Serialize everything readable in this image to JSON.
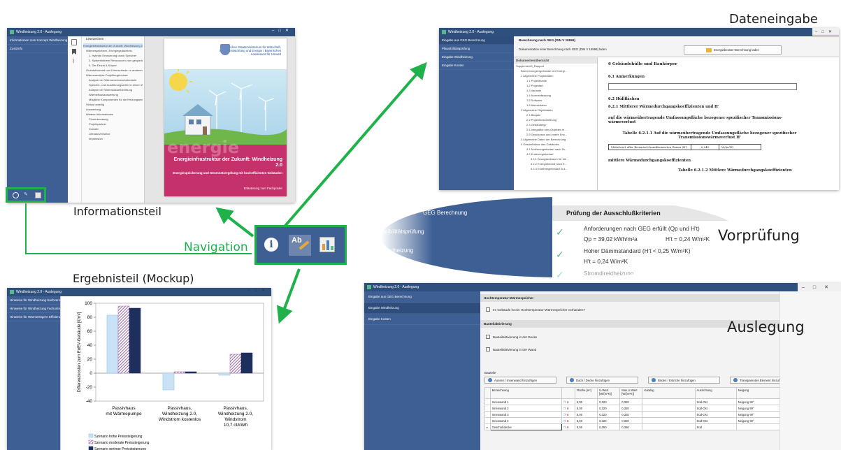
{
  "captions": {
    "dateneingabe": "Dateneingabe",
    "informationsteil": "Informationsteil",
    "navigation": "Navigation",
    "ergebnisteil": "Ergebnisteil (Mockup)",
    "vorpruefung": "Vorprüfung",
    "auslegung": "Auslegung"
  },
  "colors": {
    "accent_green": "#1fb24a",
    "sidebar_blue": "#3d5f94",
    "titlebar": "#2f4f7d",
    "check_green": "#58b88c",
    "poster_magenta": "#c5316a"
  },
  "nav_icons": [
    "info-icon",
    "spellcheck-icon",
    "chart-icon"
  ],
  "info_window": {
    "title": "Windheizung 2.0 - Auslegung",
    "sidebar": [
      "Informationen zum Konzept Windheizung",
      "Zustzinfo"
    ],
    "pane_title": "Lesezeichen",
    "tree": [
      "Energieinfrastruktur der Zukunft: Windheizung 2.0",
      "Wärmespeichern, Energiegedächtnis",
      "1. Hybride Erneuerung durch Speicher",
      "2. Systemhöhere Ressourcen zum gesparten Wärmebedarf",
      "3. Der Einzel & Körper",
      "Grundstücksart und Unterschiede zu anderen Formen der Wärmeerzeugung",
      "Wärmeanalyse Projektergebnisse",
      "Analyse der Wärmeverbrauchsbedarfe",
      "Speicher- und Ausführungsarten in einem Wohnbestand",
      "Analyse der Warmwasserbereitung",
      "Wärmeflussauswertung",
      "Mögliche Komponenten für die Heizungseinrichtung",
      "Verlust anteilig",
      "Auswertung",
      "Weitere Informationen",
      "Förderberatung",
      "Projektpartner",
      "Kontakt",
      "Literaturverweise",
      "Impressum"
    ],
    "poster": {
      "header": "Bayerisches Staatsministerium für Wirtschaft, Landesentwicklung und Energie / Bayerisches Landesamt für Umwelt",
      "watermark": "energie",
      "title": "Energieinfrastruktur der Zukunft: Windheizung 2.0",
      "subtitle": "Energiespeicherung und Stromnetzregelung mit hocheffizienten Gebäuden",
      "footer": "Erläuterung zum Fachposter"
    }
  },
  "data_window": {
    "title": "Windheizung 2.0 - Auslegung",
    "sidebar": [
      "Eingabe aus GEG Berechnung",
      "Plausibilitätsprüfung",
      "Eingabe Windheizung",
      "Eingabe Kosten"
    ],
    "header": "Berechnung nach GEG (DIN V 18599)",
    "desc": "Dokumentation einer Berechnung nach GEG (DIN V 18599) laden",
    "load_button": "Energieberater-Berechnung laden",
    "tree_header": "Dokumentenübersicht",
    "tree": [
      "Supplement3_Rapport",
      "Berechnungsergebnisse der Energi...",
      "1 Allgemeine Projektdaten",
      "1.1 Projektname",
      "1.2 Projektart",
      "1.3 Variante",
      "1.4 Normenfassung",
      "1.5 Software",
      "1.6 Adressdaten",
      "2 Allgemeine Objektdaten",
      "2.1 Baujahr",
      "2.2 Projektbeschreibung",
      "2.3 Gebäudetyp",
      "2.4 Integration des Objektes in ...",
      "2.5 Geschosse und innere Erw...",
      "3 Allgemeine Daten der Berechnung",
      "4 Gesamtbilanz des Gebäudes",
      "4.1 Nutzenergiebedarf nach Ze...",
      "4.2 Endenergiebedarf",
      "4.2.1 Bezugszeitraum für die ...",
      "4.2.2 Energiebedarf nach E...",
      "4.2.3 Endenergiebedarf in a..."
    ],
    "doc": {
      "h6": "6 Gebäudehülle und Baukörper",
      "h61": "6.1 Anmerkungen",
      "h62": "6.2 Hüllflächen",
      "h621": "6.2.1 Mittlerer Wärmedurchgangskoeffizienten und H'",
      "p1": "auf die wärmeübertragende Umfassungsfläche bezogener spezifischer Transmissions- wärmeverlust",
      "table_title": "Tabelle 6.2.1.1 Auf die wärmeübertragende Umfassungsfläche bezogener spezifischer Transmissionswärmeverlust H'",
      "row_label": "Mittelwert aller thermisch konditionierten Zonen (H')",
      "row_value": "0,242",
      "row_unit": "W/(m²K)",
      "h_mittel": "mittlere Wärmedurchgangskoeffizienten",
      "table2_title": "Tabelle 6.2.1.2 Mittlere Wärmedurchgangskoeffizienten"
    }
  },
  "vorpruefung": {
    "sidebar": [
      "GEG Berechnung",
      "Plausibilitätsprüfung",
      "Windheizung"
    ],
    "header": "Prüfung der Ausschlußkriterien",
    "items": [
      {
        "line1": "Anforderungen nach GEG erfüllt (Qp und H't)",
        "line2a": "Qp = 39,02 kWh/m²a",
        "line2b": "H't = 0,24 W/m²K"
      },
      {
        "line1": "Hoher Dämmstandard (H't < 0,25 W/m²K)",
        "line2a": "H't = 0,24 W/m²K",
        "line2b": ""
      },
      {
        "line1": "Stromdirektheizung",
        "line2a": "",
        "line2b": ""
      }
    ]
  },
  "result_window": {
    "title": "Windheizung 2.0 - Auslegung",
    "sidebar": [
      "Hinweise für Windheizung Sachverständige",
      "Hinweise für Windheizung Fachunternehmen",
      "Hinweise für Wärmeträgere Effizienzklassen"
    ]
  },
  "chart_data": {
    "type": "bar",
    "ylabel": "Differenzkosten zum EnEV-Gebäude [€/m²]",
    "ylim": [
      -40,
      100
    ],
    "yticks": [
      -40,
      -20,
      0,
      20,
      40,
      60,
      80,
      100
    ],
    "categories": [
      [
        "Passivhaus",
        "mit Wärmepumpe"
      ],
      [
        "Passivhaus,",
        "Windheizung 2.0,",
        "Windstrom kostenlos"
      ],
      [
        "Passivhaus,",
        "Windheizung 2.0,",
        "Windstrom",
        "10,7 ct/kWh"
      ]
    ],
    "series": [
      {
        "name": "Szenario hohe Preissteigerung",
        "color": "#c9e2f6",
        "values": [
          83,
          -24,
          -3
        ]
      },
      {
        "name": "Szenario moderate Preissteigerung",
        "color": "#9d67a8",
        "values": [
          96,
          2,
          27
        ]
      },
      {
        "name": "Szenario geringe Preissteigerung",
        "color": "#1f2f5c",
        "values": [
          93,
          2,
          29
        ]
      }
    ],
    "grid": false,
    "legend": "bottom"
  },
  "ausl_window": {
    "title": "Windheizung 2.0 - Auslegung",
    "sidebar": [
      "Eingabe aus GEG Berechnung",
      "Eingabe Windheizung",
      "Eingabe Kosten"
    ],
    "hts_header": "Hochtemperatur-Wärmespeicher",
    "hts_check": "Im Gebäude ist ein Hochtemperatur-Wärmespeicher vorhanden?",
    "ba_header": "Bauteilaktivierung",
    "ba_checks": [
      "Bauteilaktivierung in der Decke",
      "Bauteilaktivierung in der Wand"
    ],
    "bauteile_label": "Bauteile",
    "add_buttons": [
      "Aussen / Innenwand hinzufügen",
      "Dach / Decke hinzufügen",
      "Böden / Estriche hinzufügen",
      "Transparentes Element hinzufügen"
    ],
    "columns": [
      "Bezeichnung",
      "",
      "Fläche [m²]",
      "U-Wert [W/(m²K)]",
      "Max U-Wert [W/(m²K)]",
      "Katalog",
      "Ausrichtung",
      "Neigung"
    ],
    "rows": [
      [
        "Innenwand 1",
        "5,00",
        "0,320",
        "0,320",
        "",
        "Süd-Ost",
        "Neigung 90°"
      ],
      [
        "Innenwand 2",
        "5,00",
        "0,320",
        "0,320",
        "",
        "Süd-Ost",
        "Neigung 90°"
      ],
      [
        "Innenwand 3",
        "5,00",
        "0,320",
        "0,320",
        "",
        "Süd-Ost",
        "Neigung 90°"
      ],
      [
        "Innenwand 4",
        "5,00",
        "0,320",
        "0,320",
        "",
        "Süd-Ost",
        "Neigung 90°"
      ],
      [
        "Geschoßdecke",
        "5,00",
        "0,350",
        "0,350",
        "",
        "Süd",
        ""
      ]
    ]
  }
}
